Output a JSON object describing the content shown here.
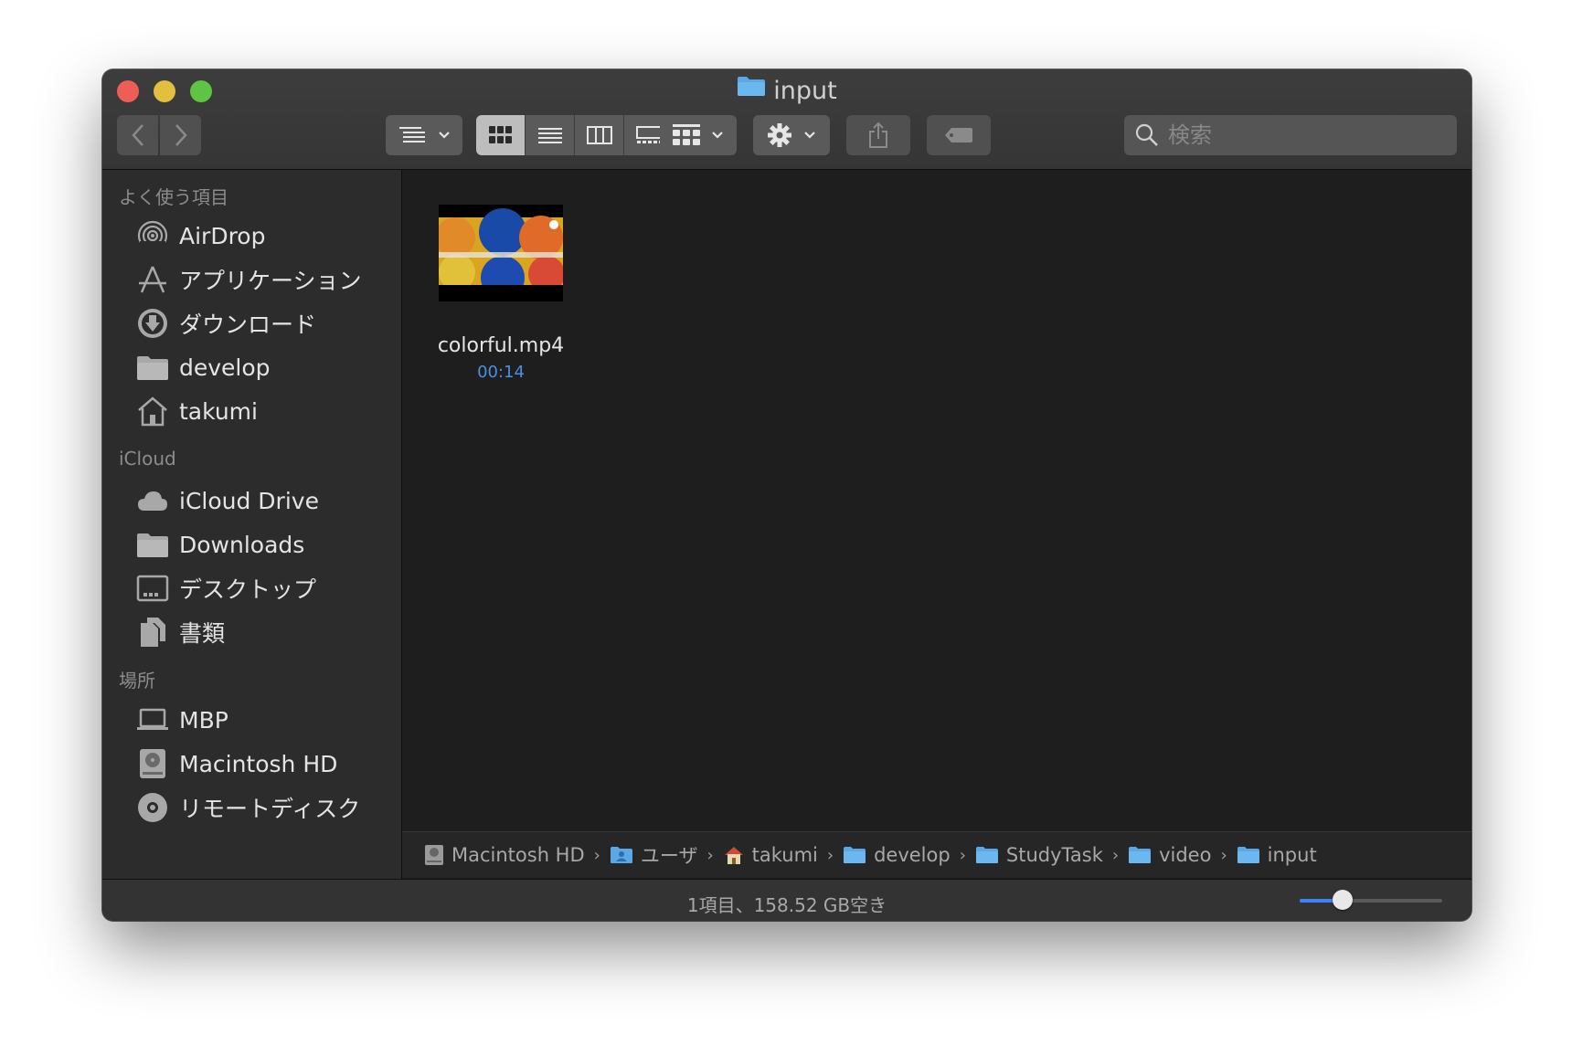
{
  "window": {
    "title": "input"
  },
  "toolbar": {
    "back_icon": "chevron-left-icon",
    "forward_icon": "chevron-right-icon",
    "view_options": [
      "icon-view",
      "list-view",
      "column-view",
      "gallery-view"
    ],
    "active_view": "icon-view",
    "search_placeholder": "検索"
  },
  "sidebar": {
    "favorites_title": "よく使う項目",
    "favorites": [
      {
        "label": "AirDrop",
        "icon": "airdrop-icon"
      },
      {
        "label": "アプリケーション",
        "icon": "applications-icon"
      },
      {
        "label": "ダウンロード",
        "icon": "download-icon"
      },
      {
        "label": "develop",
        "icon": "folder-icon"
      },
      {
        "label": "takumi",
        "icon": "home-icon"
      }
    ],
    "icloud_title": "iCloud",
    "icloud": [
      {
        "label": "iCloud Drive",
        "icon": "cloud-icon"
      },
      {
        "label": "Downloads",
        "icon": "folder-icon"
      },
      {
        "label": "デスクトップ",
        "icon": "desktop-icon"
      },
      {
        "label": "書類",
        "icon": "documents-icon"
      }
    ],
    "locations_title": "場所",
    "locations": [
      {
        "label": "MBP",
        "icon": "laptop-icon"
      },
      {
        "label": "Macintosh HD",
        "icon": "hard-drive-icon"
      },
      {
        "label": "リモートディスク",
        "icon": "disc-icon"
      }
    ]
  },
  "files": [
    {
      "name": "colorful.mp4",
      "duration": "00:14"
    }
  ],
  "pathbar": [
    {
      "label": "Macintosh HD",
      "icon": "hard-drive-icon"
    },
    {
      "label": "ユーザ",
      "icon": "users-folder-icon"
    },
    {
      "label": "takumi",
      "icon": "home-icon"
    },
    {
      "label": "develop",
      "icon": "folder-icon"
    },
    {
      "label": "StudyTask",
      "icon": "folder-icon"
    },
    {
      "label": "video",
      "icon": "folder-icon"
    },
    {
      "label": "input",
      "icon": "folder-icon"
    }
  ],
  "status": {
    "text": "1項目、158.52 GB空き",
    "icon_size_level": 0.3
  },
  "colors": {
    "accent": "#3b82f6",
    "folder": "#5aa9e6",
    "duration": "#4b8fe2"
  }
}
